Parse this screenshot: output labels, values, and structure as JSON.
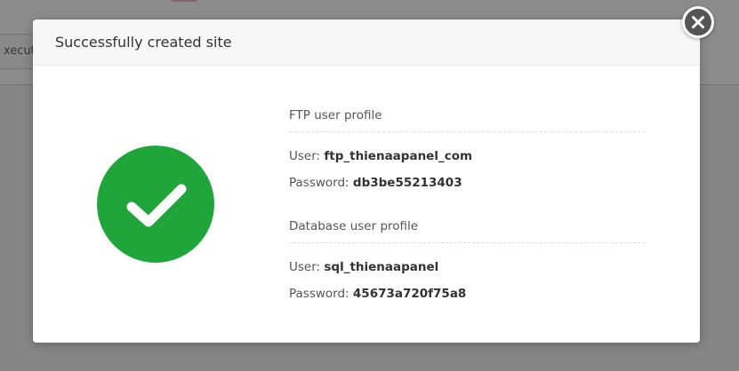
{
  "background": {
    "execute_button_label": "xecute"
  },
  "modal": {
    "title": "Successfully created site",
    "status_icon": "checkmark-icon",
    "ftp": {
      "section_title": "FTP user profile",
      "user_label": "User: ",
      "user_value": "ftp_thienaapanel_com",
      "password_label": "Password: ",
      "password_value": "db3be55213403"
    },
    "database": {
      "section_title": "Database user profile",
      "user_label": "User: ",
      "user_value": "sql_thienaapanel",
      "password_label": "Password: ",
      "password_value": "45673a720f75a8"
    },
    "close_icon": "close-icon"
  },
  "colors": {
    "success": "#20a53a",
    "close_button": "#555555"
  }
}
